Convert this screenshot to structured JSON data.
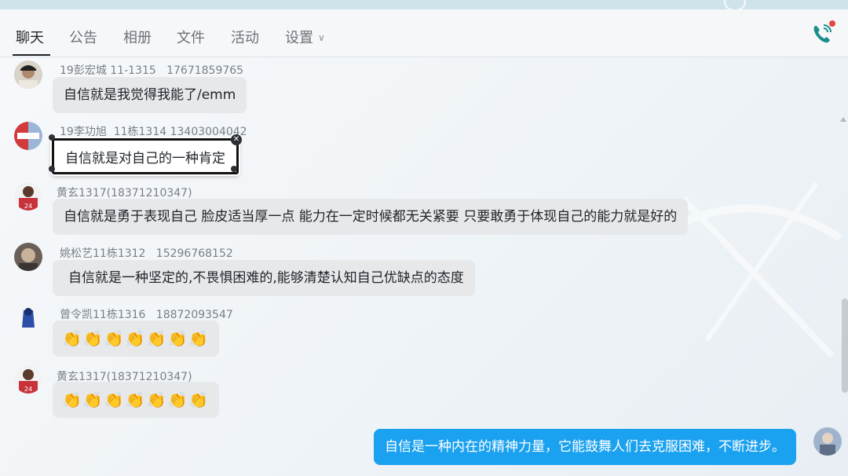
{
  "tabs": [
    {
      "label": "聊天",
      "active": true
    },
    {
      "label": "公告"
    },
    {
      "label": "相册"
    },
    {
      "label": "文件"
    },
    {
      "label": "活动"
    },
    {
      "label": "设置"
    }
  ],
  "header": {
    "call_icon": "phone-call-icon",
    "notification_dot": true
  },
  "messages": [
    {
      "sender": "19彭宏城 11-1315   17671859765",
      "text": "自信就是我觉得我能了/emm"
    },
    {
      "sender": "19李功旭  11栋1314 13403004042",
      "text": "自信就是对自己的一种肯定",
      "selected": true
    },
    {
      "sender": "黄玄1317(18371210347)",
      "text": "自信就是勇于表现自己 脸皮适当厚一点 能力在一定时候都无关紧要 只要敢勇于体现自己的能力就是好的"
    },
    {
      "sender": "姚松艺11栋1312   15296768152",
      "text": "自信就是一种坚定的,不畏惧困难的,能够清楚认知自己优缺点的态度"
    },
    {
      "sender": "曾令凯11栋1316   18872093547",
      "text": "👏👏👏👏👏👏👏"
    },
    {
      "sender": "黄玄1317(18371210347)",
      "text": "👏👏👏👏👏👏👏"
    }
  ],
  "my_message": {
    "text": "自信是一种内在的精神力量，它能鼓舞人们去克服困难，不断进步。"
  },
  "colors": {
    "my_bubble": "#1aa1f0",
    "other_bubble": "#e6e8ea",
    "accent": "#1aa1f0"
  }
}
